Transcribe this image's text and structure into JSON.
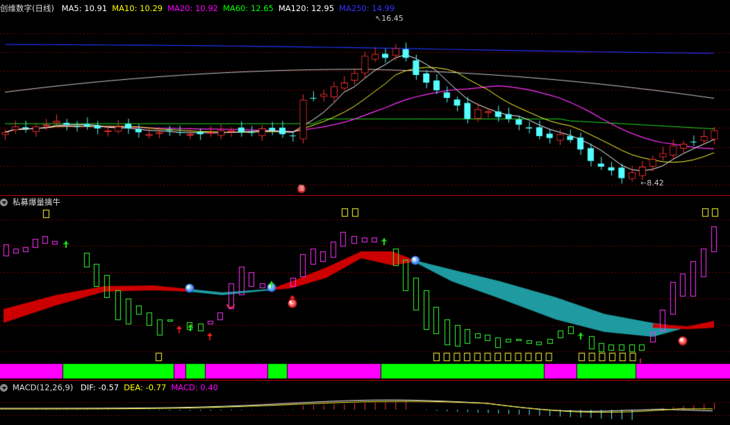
{
  "panel1": {
    "title": "创维数字(日线)",
    "ma_items": [
      {
        "label": "MA5: 10.91",
        "color": "#ffffff"
      },
      {
        "label": "MA10: 10.29",
        "color": "#ffff00"
      },
      {
        "label": "MA20: 10.92",
        "color": "#ff00ff"
      },
      {
        "label": "MA60: 12.65",
        "color": "#00ff00"
      },
      {
        "label": "MA120: 12.95",
        "color": "#ffffff"
      },
      {
        "label": "MA250: 14.99",
        "color": "#3333ff"
      }
    ],
    "high_label": "16.45",
    "low_label": "8.42",
    "event_marker": "张"
  },
  "panel2": {
    "title": "私募爆量擒牛"
  },
  "panel3": {
    "title": "MACD(12,26,9)",
    "items": [
      {
        "label": "DIF: -0.57",
        "color": "#ffffff"
      },
      {
        "label": "DEA: -0.77",
        "color": "#ffff00"
      },
      {
        "label": "MACD: 0.40",
        "color": "#ff00ff"
      }
    ]
  },
  "colors": {
    "background": "#000000",
    "up": "#ff3232",
    "down": "#54ffff",
    "separator": "#c00000",
    "grid": "#7a0000"
  },
  "chart_data": {
    "type": "candlestick",
    "series_close": [
      10.6,
      10.9,
      10.8,
      10.9,
      11.0,
      11.2,
      11.0,
      10.9,
      10.9,
      10.8,
      10.7,
      10.9,
      10.8,
      10.6,
      10.5,
      10.6,
      10.7,
      10.6,
      10.5,
      10.5,
      10.6,
      10.7,
      10.7,
      10.6,
      10.6,
      10.8,
      10.7,
      10.5,
      10.4,
      12.3,
      12.4,
      12.6,
      13.0,
      13.2,
      13.7,
      14.6,
      14.7,
      14.5,
      15.0,
      14.5,
      13.6,
      13.2,
      12.8,
      12.4,
      12.0,
      11.3,
      11.8,
      11.7,
      11.4,
      11.3,
      11.0,
      10.8,
      10.4,
      10.3,
      10.5,
      10.2,
      9.7,
      9.1,
      8.8,
      8.6,
      8.2,
      8.5,
      8.8,
      9.2,
      9.5,
      9.9,
      10.0,
      10.1,
      10.4,
      10.7
    ],
    "high": 16.45,
    "low": 8.42
  }
}
